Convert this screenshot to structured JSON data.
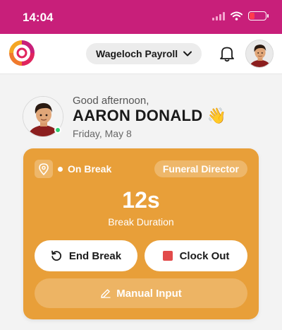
{
  "status_bar": {
    "time": "14:04",
    "battery_level": 0.3
  },
  "nav": {
    "org_name": "Wageloch Payroll"
  },
  "greeting": {
    "salutation": "Good afternoon,",
    "name": "AARON DONALD",
    "emoji": "👋",
    "date": "Friday, May 8"
  },
  "card": {
    "status": "On Break",
    "role": "Funeral Director",
    "duration": "12s",
    "duration_label": "Break Duration",
    "end_break_label": "End Break",
    "clock_out_label": "Clock Out",
    "manual_input_label": "Manual Input"
  },
  "colors": {
    "brand": "#c81f7a",
    "card": "#e89f39",
    "stop": "#e24b4b",
    "online": "#2ecc71"
  },
  "icons": [
    "wifi-icon",
    "battery-icon",
    "bell-icon",
    "chevron-down-icon",
    "location-pin-icon",
    "restart-icon",
    "stop-icon",
    "pencil-icon"
  ]
}
